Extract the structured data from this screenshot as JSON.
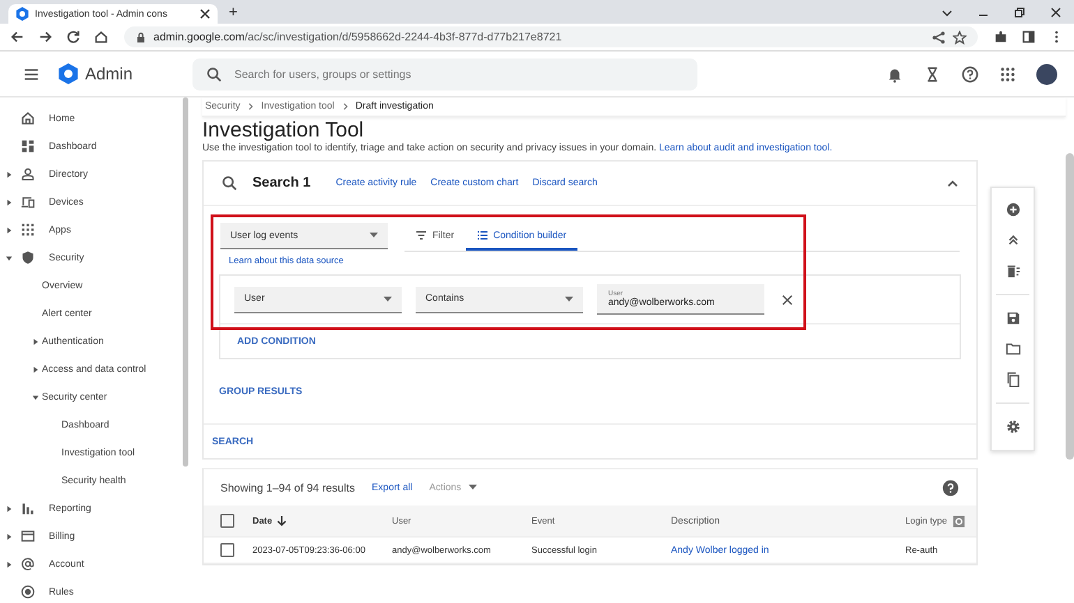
{
  "browser": {
    "tab_title": "Investigation tool - Admin cons",
    "new_tab": "+",
    "url_host": "admin.google.com",
    "url_path": "/ac/sc/investigation/d/5958662d-2244-4b3f-877d-d77b217e8721"
  },
  "header": {
    "product": "Admin",
    "search": {
      "placeholder": "Search for users, groups or settings"
    }
  },
  "sidebar": {
    "items": [
      {
        "label": "Home",
        "kind": "home"
      },
      {
        "label": "Dashboard",
        "kind": "dashboard"
      },
      {
        "label": "Directory",
        "kind": "person",
        "expanded": false
      },
      {
        "label": "Devices",
        "kind": "devices",
        "expanded": false
      },
      {
        "label": "Apps",
        "kind": "apps",
        "expanded": false
      },
      {
        "label": "Security",
        "kind": "shield",
        "expanded": true,
        "children": [
          {
            "label": "Overview"
          },
          {
            "label": "Alert center"
          },
          {
            "label": "Authentication",
            "expanded": false
          },
          {
            "label": "Access and data control",
            "expanded": false
          },
          {
            "label": "Security center",
            "expanded": true,
            "children": [
              {
                "label": "Dashboard"
              },
              {
                "label": "Investigation tool"
              },
              {
                "label": "Security health"
              }
            ]
          }
        ]
      },
      {
        "label": "Reporting",
        "kind": "bars",
        "expanded": false
      },
      {
        "label": "Billing",
        "kind": "card",
        "expanded": false
      },
      {
        "label": "Account",
        "kind": "at",
        "expanded": false
      },
      {
        "label": "Rules",
        "kind": "rules"
      }
    ]
  },
  "breadcrumb": [
    {
      "label": "Security",
      "current": false
    },
    {
      "label": "Investigation tool",
      "current": false
    },
    {
      "label": "Draft investigation",
      "current": true
    }
  ],
  "page": {
    "title": "Investigation Tool",
    "description": "Use the investigation tool to identify, triage and take action on security and privacy issues in your domain.",
    "description_link": "Learn about audit and investigation tool."
  },
  "search_card": {
    "title": "Search 1",
    "actions": [
      "Create activity rule",
      "Create custom chart",
      "Discard search"
    ],
    "data_source": {
      "value": "User log events",
      "link": "Learn about this data source"
    },
    "tabs": [
      {
        "label": "Filter",
        "kind": "filter",
        "selected": false
      },
      {
        "label": "Condition builder",
        "kind": "list",
        "selected": true
      }
    ],
    "condition": {
      "attribute": "User",
      "operator": "Contains",
      "value_label": "User",
      "value": "andy@wolberworks.com"
    },
    "add_condition": "ADD CONDITION",
    "group_results": "GROUP RESULTS",
    "search_button": "SEARCH"
  },
  "results": {
    "summary": "Showing 1–94 of 94 results",
    "export": "Export all",
    "actions": {
      "label": "Actions",
      "disabled": true
    },
    "table": {
      "all_checked": false,
      "columns": [
        {
          "label": "Date",
          "sorted": true
        },
        {
          "label": "User",
          "sorted": false
        },
        {
          "label": "Event",
          "sorted": false
        },
        {
          "label": "Description",
          "sorted": false
        },
        {
          "label": "Login type",
          "sorted": false
        }
      ],
      "rows": [
        {
          "checked": false,
          "cells": [
            "2023-07-05T09:23:36-06:00",
            "andy@wolberworks.com",
            "Successful login",
            "Andy Wolber logged in",
            "Re-auth"
          ]
        }
      ]
    }
  }
}
